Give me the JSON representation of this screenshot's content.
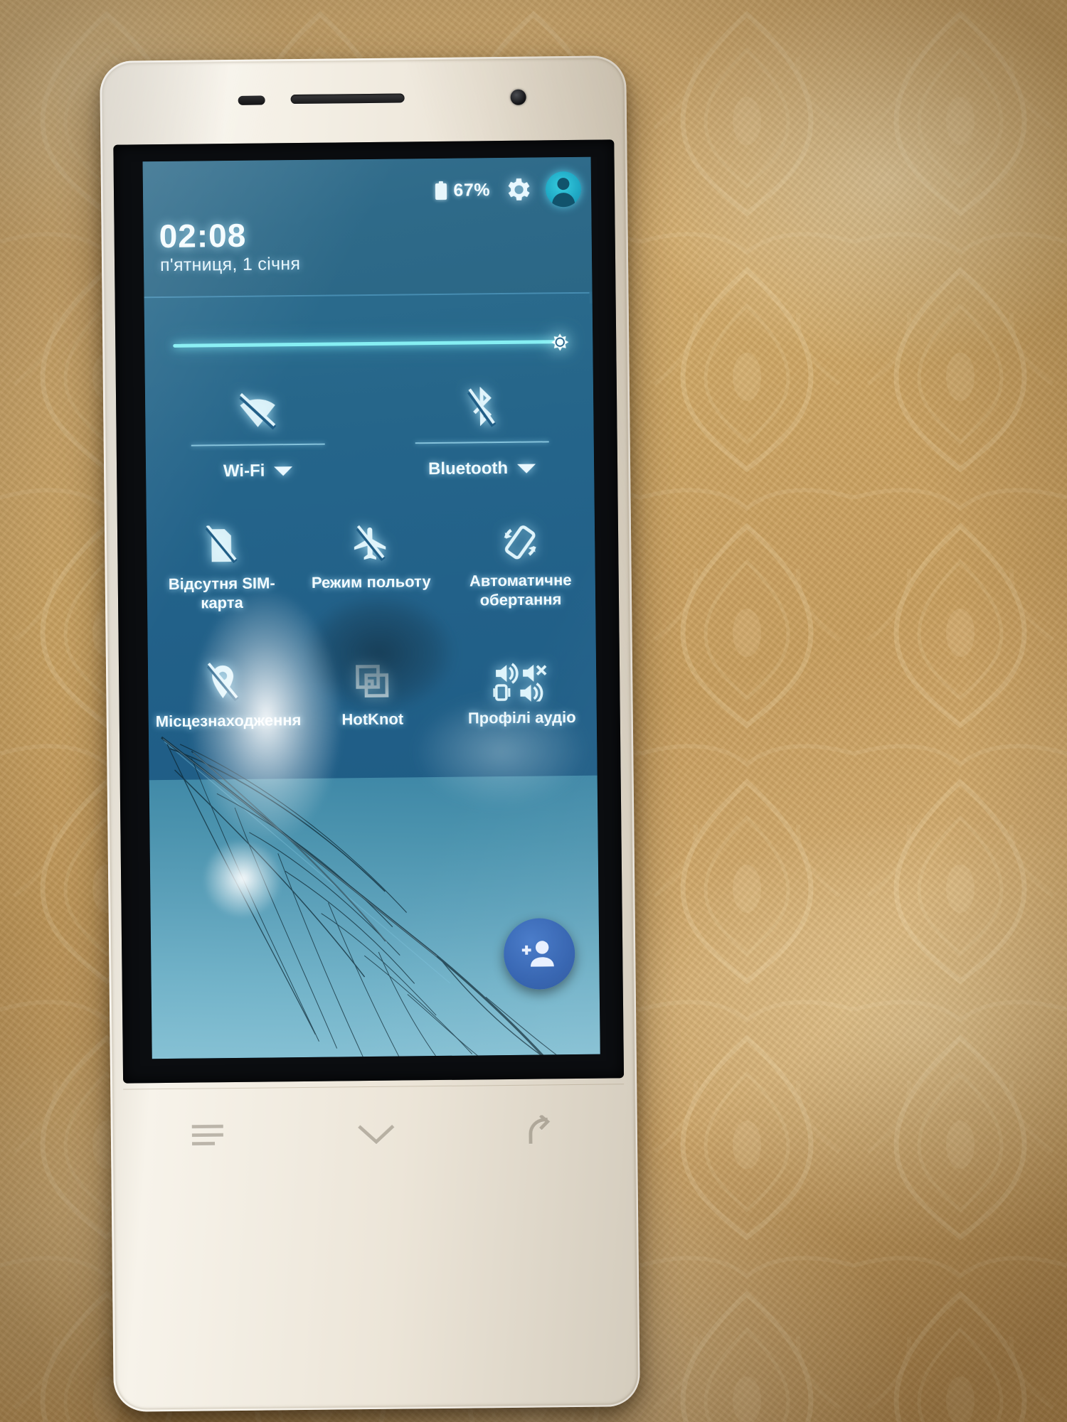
{
  "device": {
    "description": "white-smartphone-cracked-screen",
    "background": "beige-patterned-fabric"
  },
  "statusbar": {
    "battery_icon": "battery-icon",
    "battery_percent": "67%",
    "settings_icon": "gear-icon",
    "user_icon": "user-avatar-icon"
  },
  "header": {
    "time": "02:08",
    "date": "п'ятниця, 1 січня"
  },
  "brightness": {
    "slider_icon": "brightness-icon",
    "value_percent": 96
  },
  "connectivity": [
    {
      "label": "Wi-Fi",
      "icon": "wifi-off-icon",
      "caret": "chevron-down-icon",
      "state": "off"
    },
    {
      "label": "Bluetooth",
      "icon": "bluetooth-off-icon",
      "caret": "chevron-down-icon",
      "state": "off"
    }
  ],
  "tiles": [
    [
      {
        "label": "Відсутня SIM-карта",
        "icon": "sim-card-off-icon"
      },
      {
        "label": "Режим польоту",
        "icon": "airplane-mode-icon"
      },
      {
        "label": "Автоматичне обертання",
        "icon": "auto-rotate-icon"
      }
    ],
    [
      {
        "label": "Місцезнаходження",
        "icon": "location-off-icon"
      },
      {
        "label": "HotKnot",
        "icon": "hotknot-icon"
      },
      {
        "label": "Профілі аудіо",
        "icon": "audio-profiles-icon"
      }
    ]
  ],
  "wallpaper": {
    "fab_icon": "add-contact-icon"
  },
  "navbar": {
    "menu": "recents-icon",
    "home": "home-icon",
    "back": "back-icon"
  },
  "colors": {
    "panel_blue": "#22618a",
    "header_blue": "#2e6a89",
    "accent_cyan": "#86eff3",
    "text_white": "#f2fbff",
    "fab_blue": "#2f5fae",
    "wallpaper_blue": "#5ea2bb"
  }
}
